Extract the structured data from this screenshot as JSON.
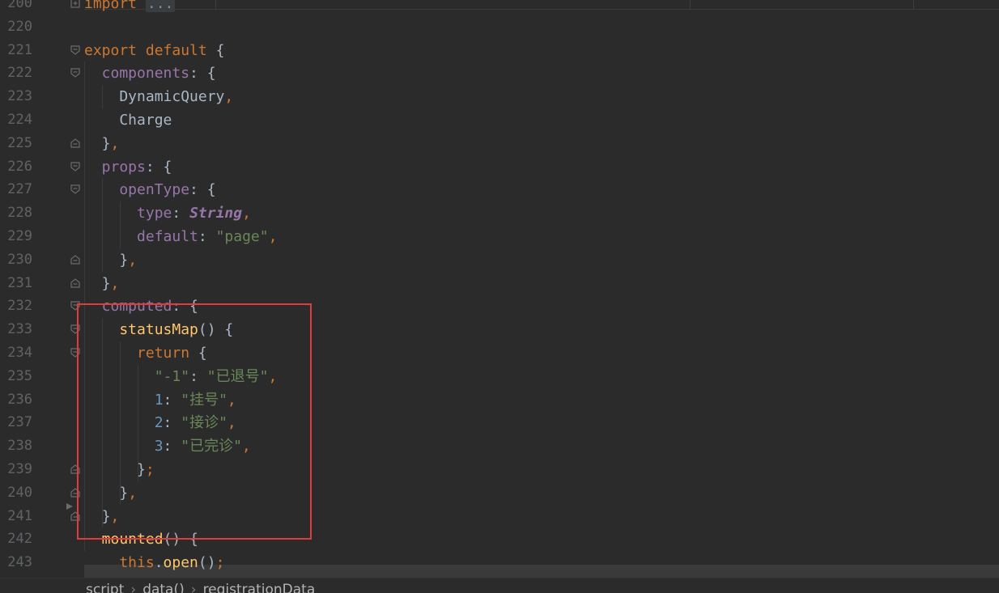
{
  "editor": {
    "lines": [
      {
        "num": "200",
        "tokens": [
          {
            "t": "import ",
            "c": "kw"
          },
          {
            "t": "...",
            "c": "fold-hint"
          }
        ]
      },
      {
        "num": "220",
        "tokens": []
      },
      {
        "num": "221",
        "tokens": [
          {
            "t": "export default ",
            "c": "kw"
          },
          {
            "t": "{",
            "c": "pl"
          }
        ]
      },
      {
        "num": "222",
        "tokens": [
          {
            "t": "  components",
            "c": "pr"
          },
          {
            "t": ": {",
            "c": "pl"
          }
        ]
      },
      {
        "num": "223",
        "tokens": [
          {
            "t": "    DynamicQuery",
            "c": "pl"
          },
          {
            "t": ",",
            "c": "kw"
          }
        ]
      },
      {
        "num": "224",
        "tokens": [
          {
            "t": "    Charge",
            "c": "pl"
          }
        ]
      },
      {
        "num": "225",
        "tokens": [
          {
            "t": "  }",
            "c": "pl"
          },
          {
            "t": ",",
            "c": "kw"
          }
        ]
      },
      {
        "num": "226",
        "tokens": [
          {
            "t": "  props",
            "c": "pr"
          },
          {
            "t": ": {",
            "c": "pl"
          }
        ]
      },
      {
        "num": "227",
        "tokens": [
          {
            "t": "    openType",
            "c": "pr"
          },
          {
            "t": ": {",
            "c": "pl"
          }
        ]
      },
      {
        "num": "228",
        "tokens": [
          {
            "t": "      type",
            "c": "pr"
          },
          {
            "t": ": ",
            "c": "pl"
          },
          {
            "t": "String",
            "c": "ty"
          },
          {
            "t": ",",
            "c": "kw"
          }
        ]
      },
      {
        "num": "229",
        "tokens": [
          {
            "t": "      default",
            "c": "pr"
          },
          {
            "t": ": ",
            "c": "pl"
          },
          {
            "t": "\"page\"",
            "c": "st"
          },
          {
            "t": ",",
            "c": "kw"
          }
        ]
      },
      {
        "num": "230",
        "tokens": [
          {
            "t": "    }",
            "c": "pl"
          },
          {
            "t": ",",
            "c": "kw"
          }
        ]
      },
      {
        "num": "231",
        "tokens": [
          {
            "t": "  }",
            "c": "pl"
          },
          {
            "t": ",",
            "c": "kw"
          }
        ]
      },
      {
        "num": "232",
        "tokens": [
          {
            "t": "  computed",
            "c": "pr"
          },
          {
            "t": ": {",
            "c": "pl"
          }
        ]
      },
      {
        "num": "233",
        "tokens": [
          {
            "t": "    statusMap",
            "c": "fn"
          },
          {
            "t": "() {",
            "c": "pl"
          }
        ]
      },
      {
        "num": "234",
        "tokens": [
          {
            "t": "      return ",
            "c": "kw"
          },
          {
            "t": "{",
            "c": "pl"
          }
        ]
      },
      {
        "num": "235",
        "tokens": [
          {
            "t": "        ",
            "c": "pl"
          },
          {
            "t": "\"-1\"",
            "c": "st"
          },
          {
            "t": ": ",
            "c": "pl"
          },
          {
            "t": "\"已退号\"",
            "c": "st"
          },
          {
            "t": ",",
            "c": "kw"
          }
        ]
      },
      {
        "num": "236",
        "tokens": [
          {
            "t": "        ",
            "c": "pl"
          },
          {
            "t": "1",
            "c": "nm"
          },
          {
            "t": ": ",
            "c": "pl"
          },
          {
            "t": "\"挂号\"",
            "c": "st"
          },
          {
            "t": ",",
            "c": "kw"
          }
        ]
      },
      {
        "num": "237",
        "tokens": [
          {
            "t": "        ",
            "c": "pl"
          },
          {
            "t": "2",
            "c": "nm"
          },
          {
            "t": ": ",
            "c": "pl"
          },
          {
            "t": "\"接诊\"",
            "c": "st"
          },
          {
            "t": ",",
            "c": "kw"
          }
        ]
      },
      {
        "num": "238",
        "tokens": [
          {
            "t": "        ",
            "c": "pl"
          },
          {
            "t": "3",
            "c": "nm"
          },
          {
            "t": ": ",
            "c": "pl"
          },
          {
            "t": "\"已完诊\"",
            "c": "st"
          },
          {
            "t": ",",
            "c": "kw"
          }
        ]
      },
      {
        "num": "239",
        "tokens": [
          {
            "t": "      }",
            "c": "pl"
          },
          {
            "t": ";",
            "c": "kw"
          }
        ]
      },
      {
        "num": "240",
        "tokens": [
          {
            "t": "    }",
            "c": "pl"
          },
          {
            "t": ",",
            "c": "kw"
          }
        ]
      },
      {
        "num": "241",
        "tokens": [
          {
            "t": "  }",
            "c": "pl"
          },
          {
            "t": ",",
            "c": "kw"
          }
        ]
      },
      {
        "num": "242",
        "tokens": [
          {
            "t": "  mounted",
            "c": "fn"
          },
          {
            "t": "() {",
            "c": "pl"
          }
        ]
      },
      {
        "num": "243",
        "tokens": [
          {
            "t": "    this",
            "c": "kw"
          },
          {
            "t": ".",
            "c": "pl"
          },
          {
            "t": "open",
            "c": "fn"
          },
          {
            "t": "()",
            "c": "pl"
          },
          {
            "t": ";",
            "c": "kw"
          }
        ]
      }
    ],
    "fold_markers": {
      "open": [
        "200",
        "221",
        "222",
        "226",
        "227",
        "232",
        "233",
        "234"
      ],
      "close": [
        "225",
        "230",
        "231",
        "239",
        "240",
        "241"
      ]
    },
    "breakpoint_line": "240"
  },
  "breadcrumb": {
    "items": [
      "script",
      "data()",
      "registrationData"
    ]
  },
  "colors": {
    "background": "#2b2b2b",
    "keyword": "#cc7832",
    "property": "#9876aa",
    "function": "#ffc66d",
    "string": "#6a8759",
    "number": "#6897bb",
    "plain": "#a9b7c6",
    "line_number": "#606366",
    "highlight_box": "#e03c3c"
  }
}
